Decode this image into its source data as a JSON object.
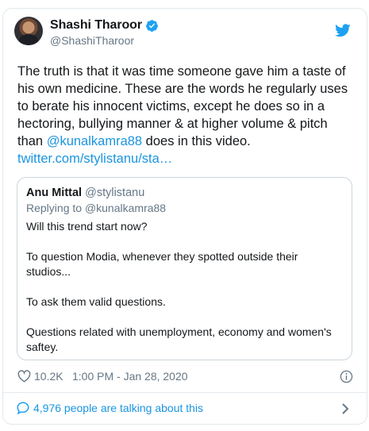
{
  "author": {
    "name": "Shashi Tharoor",
    "handle": "@ShashiTharoor",
    "verified": true
  },
  "tweet": {
    "text_before": "The truth is that it was time someone gave him a taste of his own medicine. These are the words he regularly uses to berate his innocent victims, except he does so in a hectoring, bullying manner & at higher volume & pitch than ",
    "mention": "@kunalkamra88",
    "text_after": " does in this video.",
    "link": "twitter.com/stylistanu/sta…"
  },
  "quoted_tweet": {
    "name": "Anu Mittal",
    "handle": "@stylistanu",
    "reply_prefix": "Replying to ",
    "reply_to": "@kunalkamra88",
    "paragraphs": [
      "Will this trend start now?",
      "To question Modia, whenever they spotted outside their studios...",
      "To ask them valid questions.",
      "Questions related with unemployment, economy and women's saftey."
    ]
  },
  "meta": {
    "likes": "10.2K",
    "timestamp": "1:00 PM - Jan 28, 2020"
  },
  "footer": {
    "talking": "4,976 people are talking about this"
  },
  "icons": {
    "verified": "verified-badge-icon",
    "bird": "twitter-bird-icon",
    "heart": "heart-icon",
    "info": "info-icon",
    "comment": "comment-bubble-icon",
    "chevron": "chevron-right-icon"
  },
  "colors": {
    "accent": "#1da1f2",
    "link": "#1b95e0",
    "muted": "#657786",
    "text": "#14171a",
    "border": "#e1e8ed"
  }
}
